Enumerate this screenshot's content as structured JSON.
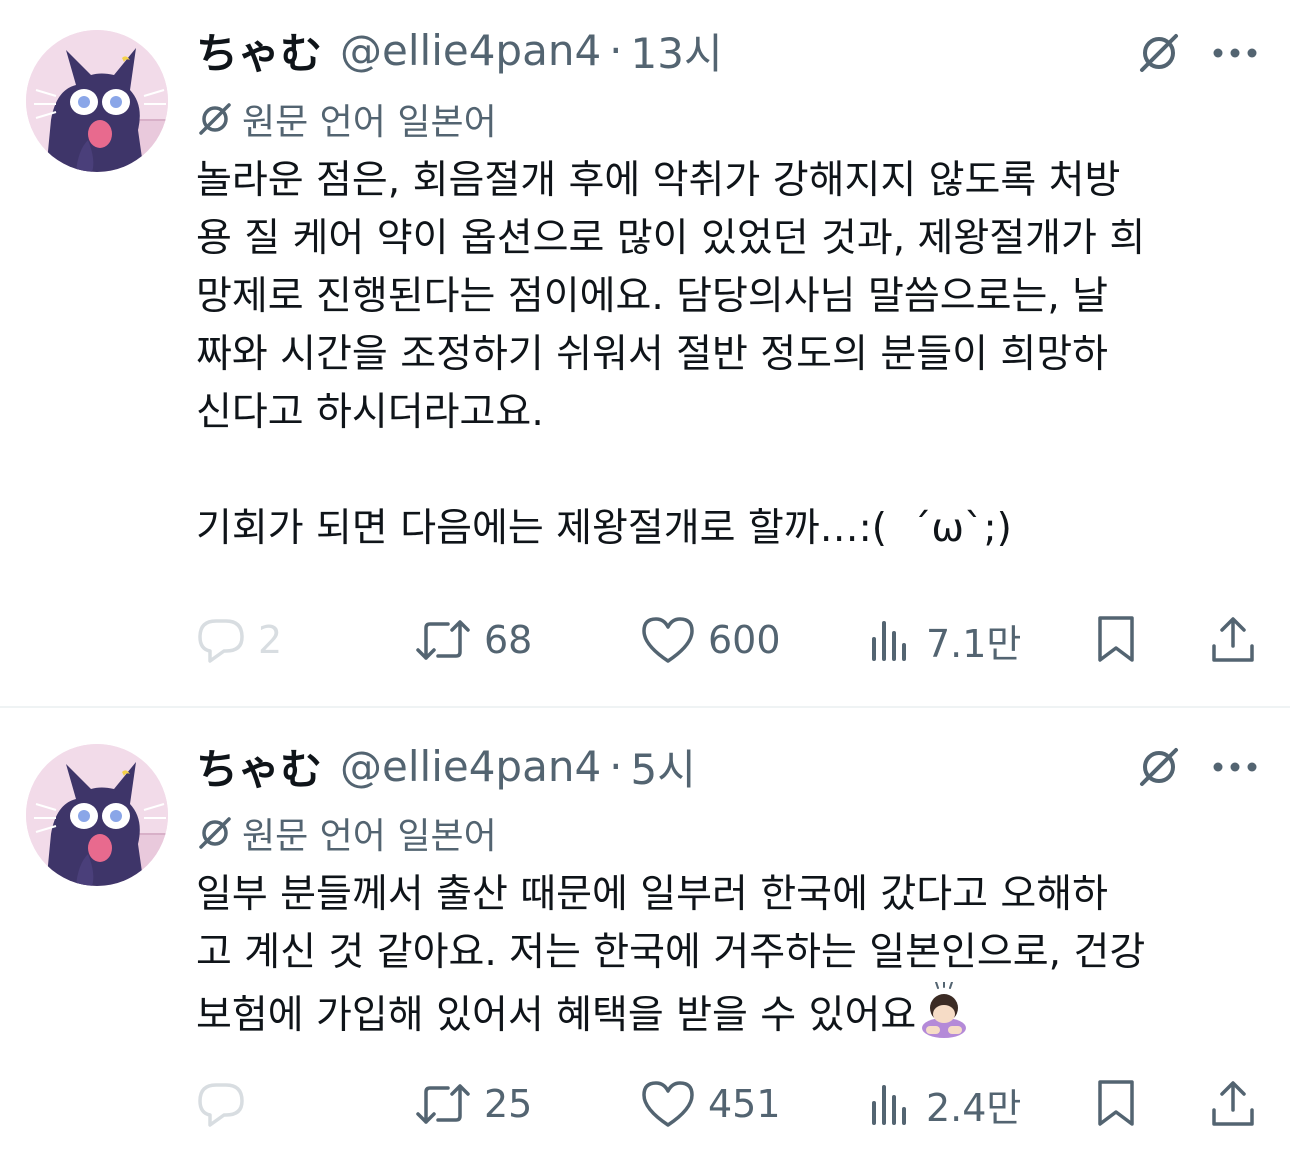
{
  "tweets": [
    {
      "display_name": "ちゃむ",
      "handle": "@ellie4pan4",
      "separator": "·",
      "time": "13시",
      "translate_label": "원문 언어 일본어",
      "text": "놀라운 점은, 회음절개 후에 악취가 강해지지 않도록 처방\n용 질 케어 약이 옵션으로 많이 있었던 것과, 제왕절개가 희\n망제로 진행된다는 점이에요. 담당의사님 말씀으로는, 날\n짜와 시간을 조정하기 쉬워서 절반 정도의 분들이 희망하\n신다고 하시더라고요.\n\n기회가 되면 다음에는 제왕절개로 할까…:(  ´ω`;)",
      "emoji": "",
      "replies": "2",
      "retweets": "68",
      "likes": "600",
      "views": "7.1만"
    },
    {
      "display_name": "ちゃむ",
      "handle": "@ellie4pan4",
      "separator": "·",
      "time": "5시",
      "translate_label": "원문 언어 일본어",
      "text": "일부 분들께서 출산 때문에 일부러 한국에 갔다고 오해하\n고 계신 것 같아요. 저는 한국에 거주하는 일본인으로, 건강\n보험에 가입해 있어서 혜택을 받을 수 있어요",
      "emoji": "person-bowing-emoji",
      "replies": "",
      "retweets": "25",
      "likes": "451",
      "views": "2.4만"
    }
  ],
  "icons": {
    "reply": "reply-icon",
    "retweet": "retweet-icon",
    "like": "heart-icon",
    "views": "views-icon",
    "bookmark": "bookmark-icon",
    "share": "share-icon",
    "grok": "grok-icon",
    "more": "more-icon",
    "translate": "translate-icon"
  },
  "colors": {
    "text": "#0f1419",
    "secondary": "#536471",
    "faded": "#d8dde1",
    "divider": "#eff3f4",
    "avatar_bg": "#f2dbe9"
  }
}
